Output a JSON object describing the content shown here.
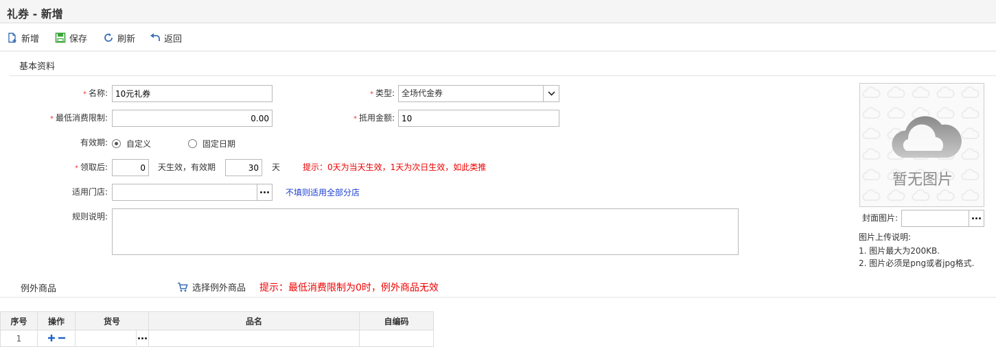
{
  "window": {
    "title": "礼券 - 新增"
  },
  "toolbar": {
    "add": {
      "label": "新增",
      "icon": "add-doc-icon"
    },
    "save": {
      "label": "保存",
      "icon": "save-icon"
    },
    "refresh": {
      "label": "刷新",
      "icon": "refresh-icon"
    },
    "back": {
      "label": "返回",
      "icon": "back-arrow-icon"
    }
  },
  "basic": {
    "section_label": "基本资料",
    "name_label": "名称:",
    "name_value": "10元礼券",
    "type_label": "类型:",
    "type_value": "全场代金券",
    "min_spend_label": "最低消费限制:",
    "min_spend_value": "0.00",
    "deduct_label": "抵用金额:",
    "deduct_value": "10",
    "validity_label": "有效期:",
    "validity_options": [
      "自定义",
      "固定日期"
    ],
    "validity_selected": "自定义",
    "after_receive_label": "领取后:",
    "after_receive_days": "0",
    "effective_text": "天生效，有效期",
    "valid_days": "30",
    "day_unit": "天",
    "validity_hint": "提示：0天为当天生效，1天为次日生效，如此类推",
    "store_label": "适用门店:",
    "store_value": "",
    "store_hint": "不填则适用全部分店",
    "rules_label": "规则说明:",
    "rules_value": ""
  },
  "cover": {
    "placeholder_text": "暂无图片",
    "cover_label": "封面图片:",
    "cover_value": "",
    "upload_title": "图片上传说明:",
    "upload_rule_1": "1. 图片最大为200KB.",
    "upload_rule_2": "2. 图片必须是png或者jpg格式."
  },
  "exceptions": {
    "section_label": "例外商品",
    "select_label": "选择例外商品",
    "hint": "提示：最低消费限制为0时，例外商品无效",
    "columns": [
      "序号",
      "操作",
      "货号",
      "品名",
      "自编码"
    ],
    "rows": [
      {
        "index": "1",
        "sku": "",
        "name": "",
        "code": ""
      }
    ]
  },
  "colors": {
    "required": "#e33333",
    "hint_red": "#e00000",
    "hint_blue": "#1a3fd0",
    "save_green": "#3aa53a",
    "icon_blue": "#3b6fb6"
  }
}
